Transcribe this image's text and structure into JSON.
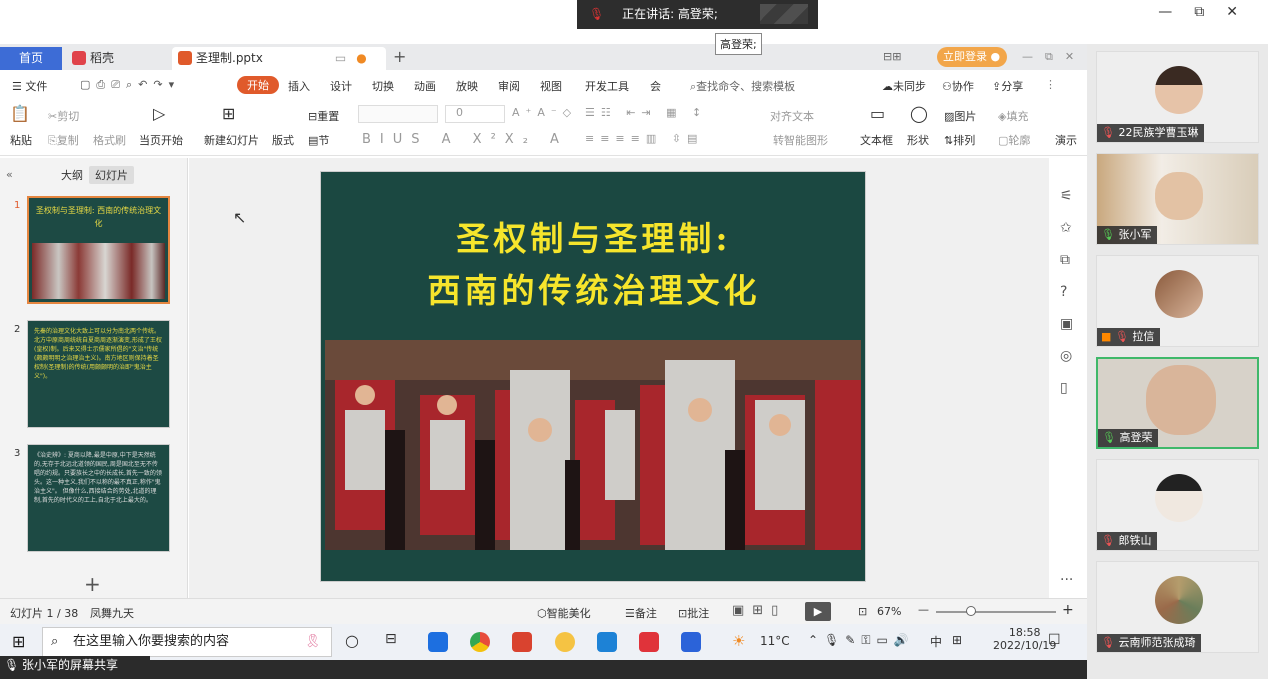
{
  "meeting": {
    "speaker_text": "正在讲话: 高登荣;",
    "tooltip": "高登荣;",
    "share_label": "张小军的屏幕共享"
  },
  "window_controls": [
    "—",
    "⧉",
    "✕"
  ],
  "tabs": {
    "home": "首页",
    "dao": "稻壳",
    "file": "圣理制.pptx",
    "login": "立即登录"
  },
  "menu": {
    "file": "文件",
    "start": "开始",
    "insert": "插入",
    "design": "设计",
    "switch": "切换",
    "animation": "动画",
    "play": "放映",
    "review": "审阅",
    "view": "视图",
    "dev": "开发工具",
    "member": "会",
    "search": "查找命令、搜索模板",
    "unsync": "未同步",
    "collab": "协作",
    "share": "分享"
  },
  "ribbon": {
    "paste": "粘贴",
    "cut": "剪切",
    "copy": "复制",
    "format_painter": "格式刷",
    "from_current": "当页开始",
    "new_slide": "新建幻灯片",
    "layout": "版式",
    "reset": "重置",
    "section": "节",
    "font_size": "0",
    "text_box": "文本框",
    "shape": "形状",
    "picture": "图片",
    "arrange": "排列",
    "fill": "填充",
    "outline": "轮廓",
    "align_text": "对齐文本",
    "smart": "转智能图形",
    "play_label": "演示"
  },
  "panel": {
    "outline": "大纲",
    "slides": "幻灯片"
  },
  "thumbs": [
    {
      "num": "1",
      "text": "圣权制与圣理制: 西南的传统治理文化"
    },
    {
      "num": "2",
      "text": "先秦的治理文化大致上可以分为南北两个传统。北方中原商周统统自夏商周逐渐演变,形成了王权(皇权)制。后来又得士示儒家所倡的\"文治\"传统(颇颇明明之治理治主义)。南方地区则保持着圣权制(圣理制)的传统(用颇颇明的治即\"鬼治主义\")。"
    },
    {
      "num": "3",
      "text": "《治史辨》: 夏商以降,最是中原,中下是天然统的,无存于北远北道领的国民,周是国北至无不传唱的约规。只要族长之中的长成长,首先一致的领头。这一种主义,我们不以称的最不真正,称作\"鬼治主义\"。 但像什么,西接结合的势处,北道的理制,首先的时代义的工上,自北于北上最大的。"
    }
  ],
  "slide": {
    "title_line1": "圣权制与圣理制:",
    "title_line2": "西南的传统治理文化"
  },
  "status": {
    "slide_count": "幻灯片 1 / 38",
    "theme": "凤舞九天",
    "beautify": "智能美化",
    "notes": "备注",
    "comment": "批注",
    "zoom": "67%"
  },
  "taskbar": {
    "search": "在这里输入你要搜索的内容",
    "weather": "11°C",
    "ime": "中",
    "time": "18:58",
    "date": "2022/10/19"
  },
  "participants": [
    {
      "name": "22民族学曹玉琳"
    },
    {
      "name": "张小军"
    },
    {
      "name": "拉信"
    },
    {
      "name": "高登荣"
    },
    {
      "name": "郎铁山"
    },
    {
      "name": "云南师范张成琦"
    }
  ]
}
